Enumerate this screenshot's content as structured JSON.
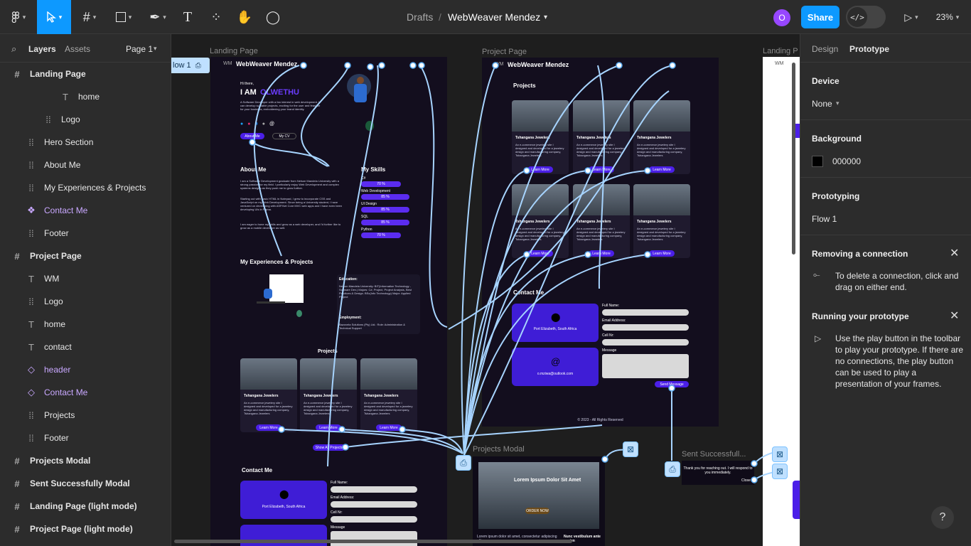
{
  "topbar": {
    "breadcrumb_root": "Drafts",
    "separator": "/",
    "file_name": "WebWeaver Mendez",
    "avatar_initial": "O",
    "share_label": "Share",
    "zoom": "23%"
  },
  "layers_panel": {
    "tab_layers": "Layers",
    "tab_assets": "Assets",
    "page_label": "Page 1",
    "items": [
      {
        "label": "Landing Page",
        "icon": "frame-icon",
        "indent": 0
      },
      {
        "label": "home",
        "icon": "text-icon",
        "indent": 2
      },
      {
        "label": "Logo",
        "icon": "group-icon",
        "indent": 1
      },
      {
        "label": "Hero Section",
        "icon": "group-icon",
        "indent": 0
      },
      {
        "label": "About Me",
        "icon": "group-icon",
        "indent": 0
      },
      {
        "label": "My Experiences & Projects",
        "icon": "group-icon",
        "indent": 0
      },
      {
        "label": "Contact Me",
        "icon": "component-icon",
        "indent": 0
      },
      {
        "label": "Footer",
        "icon": "group-icon",
        "indent": 0
      },
      {
        "label": "Project Page",
        "icon": "frame-icon",
        "indent": 0
      },
      {
        "label": "WM",
        "icon": "text-icon",
        "indent": 0
      },
      {
        "label": "Logo",
        "icon": "group-icon",
        "indent": 0
      },
      {
        "label": "home",
        "icon": "text-icon",
        "indent": 0
      },
      {
        "label": "contact",
        "icon": "text-icon",
        "indent": 0
      },
      {
        "label": "header",
        "icon": "instance-icon",
        "indent": 0
      },
      {
        "label": "Contact Me",
        "icon": "instance-icon",
        "indent": 0
      },
      {
        "label": "Projects",
        "icon": "group-icon",
        "indent": 0
      },
      {
        "label": "Footer",
        "icon": "group-icon",
        "indent": 0
      },
      {
        "label": "Projects Modal",
        "icon": "frame-icon",
        "indent": 0
      },
      {
        "label": "Sent Successfully Modal",
        "icon": "frame-icon",
        "indent": 0
      },
      {
        "label": "Landing Page (light mode)",
        "icon": "frame-icon",
        "indent": 0
      },
      {
        "label": "Project Page (light mode)",
        "icon": "frame-icon",
        "indent": 0
      }
    ]
  },
  "canvas": {
    "frame_labels": {
      "landing": "Landing Page",
      "project": "Project Page",
      "landing_light": "Landing P",
      "modal": "Projects Modal",
      "sent": "Sent Successfull..."
    },
    "flow_tag": "low 1",
    "landing": {
      "brand": "WebWeaver Mendez",
      "greeting": "Hi there,",
      "headline_prefix": "I AM",
      "headline_name": "OLWETHU",
      "intro": "A Software Developer with a fan interest in web development. I can develop scalable projects, exciting for the user and feasible for your business, emboldening your brand identity.",
      "btn_about": "About Me",
      "btn_cv": "My CV",
      "about_title": "About Me",
      "about_p1": "I am a Software Development graduate from Nelson Mandela University with a strong passion for my field. I particularly enjoy Web Development and complex systems designs as they push me to grow further.",
      "about_p2": "Starting out with basic HTML in Notepad, I grew to incorporate CSS and JavaScript on my Web Development. Since being a University student, I have ventured on developing with ASP.Net Core MVC web apps and I have even been developing UIs in Figma.",
      "about_p3": "I am eager to hone my skills and grow as a web developer, and I'd further like to grow as a mobile developer as well.",
      "skills_title": "My Skills",
      "skills": [
        {
          "name": "C#",
          "value": "70 %"
        },
        {
          "name": "Web Development",
          "value": "85 %"
        },
        {
          "name": "UI Design",
          "value": "85 %"
        },
        {
          "name": "SQL",
          "value": "85 %"
        },
        {
          "name": "Python",
          "value": "70 %"
        }
      ],
      "exp_title": "My Experiences & Projects",
      "education_label": "Education:",
      "education_text": "Nelson Mandela University: BIT(Information Technology - Software Dev.) Majors: C#, Project, Project Analysis, Best Practices & Design. BSc(Info Technology) Major: Applied Project",
      "employment_label": "Employment:",
      "employment_text": "Bazovela Solutions (Pty) Ltd.: Role: Administration & Technical Support",
      "projects_title": "Projects",
      "card_title": "Tshangana Jewelers",
      "card_text": "An e-commerce jewelery site I designed and developed for a jewelery design and manufacturing company, Tshangana Jewelers",
      "learn_more": "Learn More",
      "show_all": "Show All Projects",
      "contact_title": "Contact Me",
      "location": "Port Elizabeth, South Africa",
      "form": {
        "name": "Full Name:",
        "email": "Email Address:",
        "cell": "Cell Nr:",
        "message": "Message"
      }
    },
    "project_page": {
      "brand": "WebWeaver Mendez",
      "projects_title": "Projects",
      "contact_title": "Contact Me",
      "location": "Port Elizabeth, South Africa",
      "email": "o.mziwa@outlook.com",
      "send": "Send Message",
      "footer": "© 2023 - All Rights Reserved",
      "form": {
        "name": "Full Name:",
        "email": "Email Address:",
        "cell": "Cell Nr:",
        "message": "Message"
      }
    },
    "modal": {
      "title": "Lorem Ipsum Dolor Sit Amet",
      "btn": "ORDER NOW",
      "body": "Lorem ipsum dolor sit amet, consectetur adipiscing elit.",
      "col2": "Nunc vestibulum ante sapien"
    },
    "sent": {
      "message": "Thank you for reaching out. I will respond to you immediately.",
      "close": "Close"
    }
  },
  "right_panel": {
    "tab_design": "Design",
    "tab_prototype": "Prototype",
    "device_title": "Device",
    "device_value": "None",
    "background_title": "Background",
    "background_value": "000000",
    "background_color": "#000000",
    "prototyping_title": "Prototyping",
    "flow_value": "Flow 1",
    "tip1_title": "Removing a connection",
    "tip1_text": "To delete a connection, click and drag on either end.",
    "tip2_title": "Running your prototype",
    "tip2_text": "Use the play button in the toolbar to play your prototype. If there are no connections, the play button can be used to play a presentation of your frames.",
    "help": "?"
  }
}
